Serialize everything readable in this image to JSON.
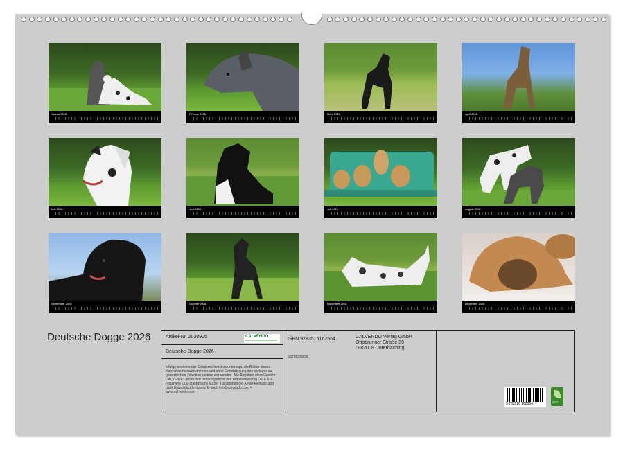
{
  "calendar_title": "Deutsche Dogge 2026",
  "months": [
    {
      "label": "Januar 2026",
      "scene": "bg-green"
    },
    {
      "label": "Februar 2026",
      "scene": "bg-green"
    },
    {
      "label": "März 2026",
      "scene": "bg-field"
    },
    {
      "label": "April 2026",
      "scene": "bg-sky"
    },
    {
      "label": "Mai 2026",
      "scene": "bg-green"
    },
    {
      "label": "Juni 2026",
      "scene": "bg-field"
    },
    {
      "label": "Juli 2026",
      "scene": "bg-green"
    },
    {
      "label": "August 2026",
      "scene": "bg-green"
    },
    {
      "label": "September 2026",
      "scene": "bg-blue"
    },
    {
      "label": "Oktober 2026",
      "scene": "bg-green"
    },
    {
      "label": "November 2026",
      "scene": "bg-field"
    },
    {
      "label": "Dezember 2026",
      "scene": "bg-sand"
    }
  ],
  "info": {
    "article": "Artikel-Nr. 2030906",
    "name": "Deutsche Dogge 2026",
    "logo": "CALVENDO",
    "legal": "Infolge bestehender Schutzrechte ist es untersagt, die Blätter dieses Kalenders herauszutrennen und ohne Genehmigung des Verlages zu gewerblichen Zwecken weiterzuverwenden. Alle Angaben ohne Gewähr. CALVENDO produziert bedarfsgerecht und klimabewusst in DE & EU. Positivere CO2-Bilanz dank kurzer Transportwege. Abfall-Reduzierung dank Einzelstückfertigung. E-Mail: info@calvendo.com • www.calvendo.com",
    "isbn": "ISBN 9783516162554",
    "author": "Sigrid Starick",
    "publisher_line1": "CALVENDO Verlag GmbH",
    "publisher_line2": "Ottobrunner Straße 39",
    "publisher_line3": "D-82008 Unterhaching",
    "barcode_number": "9 783516 162554",
    "eco_label": "ECO"
  }
}
